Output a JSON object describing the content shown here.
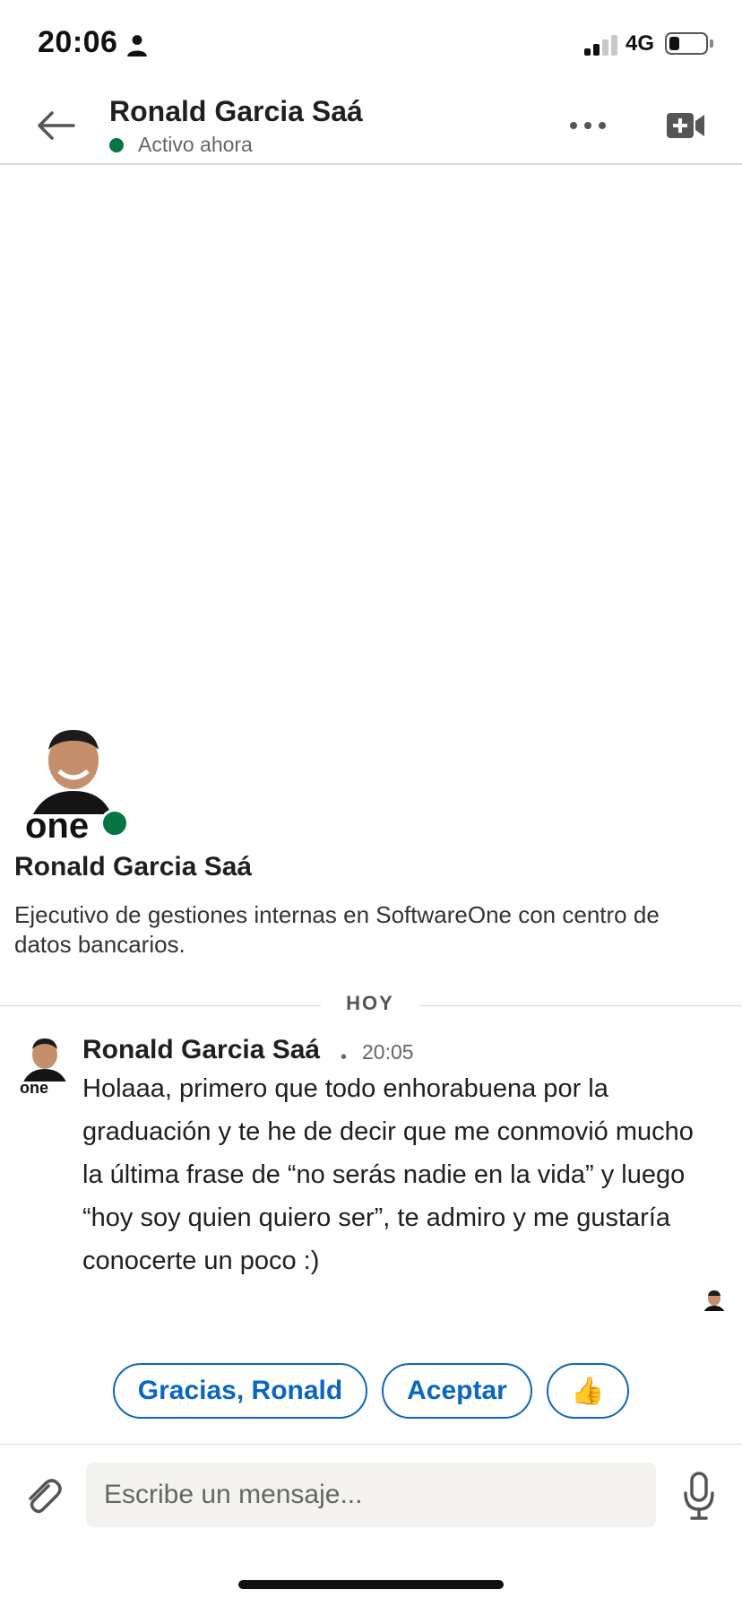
{
  "status_bar": {
    "time": "20:06",
    "network": "4G",
    "icons": [
      "person-icon",
      "signal-icon",
      "battery-icon"
    ]
  },
  "header": {
    "name": "Ronald Garcia Saá",
    "presence": "Activo ahora",
    "icons": [
      "back-arrow-icon",
      "more-icon",
      "video-call-icon"
    ]
  },
  "profile": {
    "name": "Ronald Garcia Saá",
    "headline": "Ejecutivo de gestiones internas en SoftwareOne con centro de datos bancarios."
  },
  "divider": {
    "label": "HOY"
  },
  "message": {
    "sender": "Ronald Garcia Saá",
    "separator": "•",
    "time": "20:05",
    "text": "Holaaa, primero que todo enhorabuena por la graduación y te he de decir que me conmovió mucho la última frase de “no serás nadie en la vida” y luego “hoy soy quien quiero ser”, te admiro y me gustaría conocerte un poco :)"
  },
  "quick_replies": [
    {
      "label": "Gracias, Ronald"
    },
    {
      "label": "Aceptar"
    },
    {
      "label": "👍"
    }
  ],
  "composer": {
    "placeholder": "Escribe un mensaje...",
    "icons": [
      "paperclip-icon",
      "microphone-icon"
    ]
  },
  "colors": {
    "accent": "#0a66c2",
    "online": "#057642",
    "input_bg": "#f3f2ef"
  }
}
